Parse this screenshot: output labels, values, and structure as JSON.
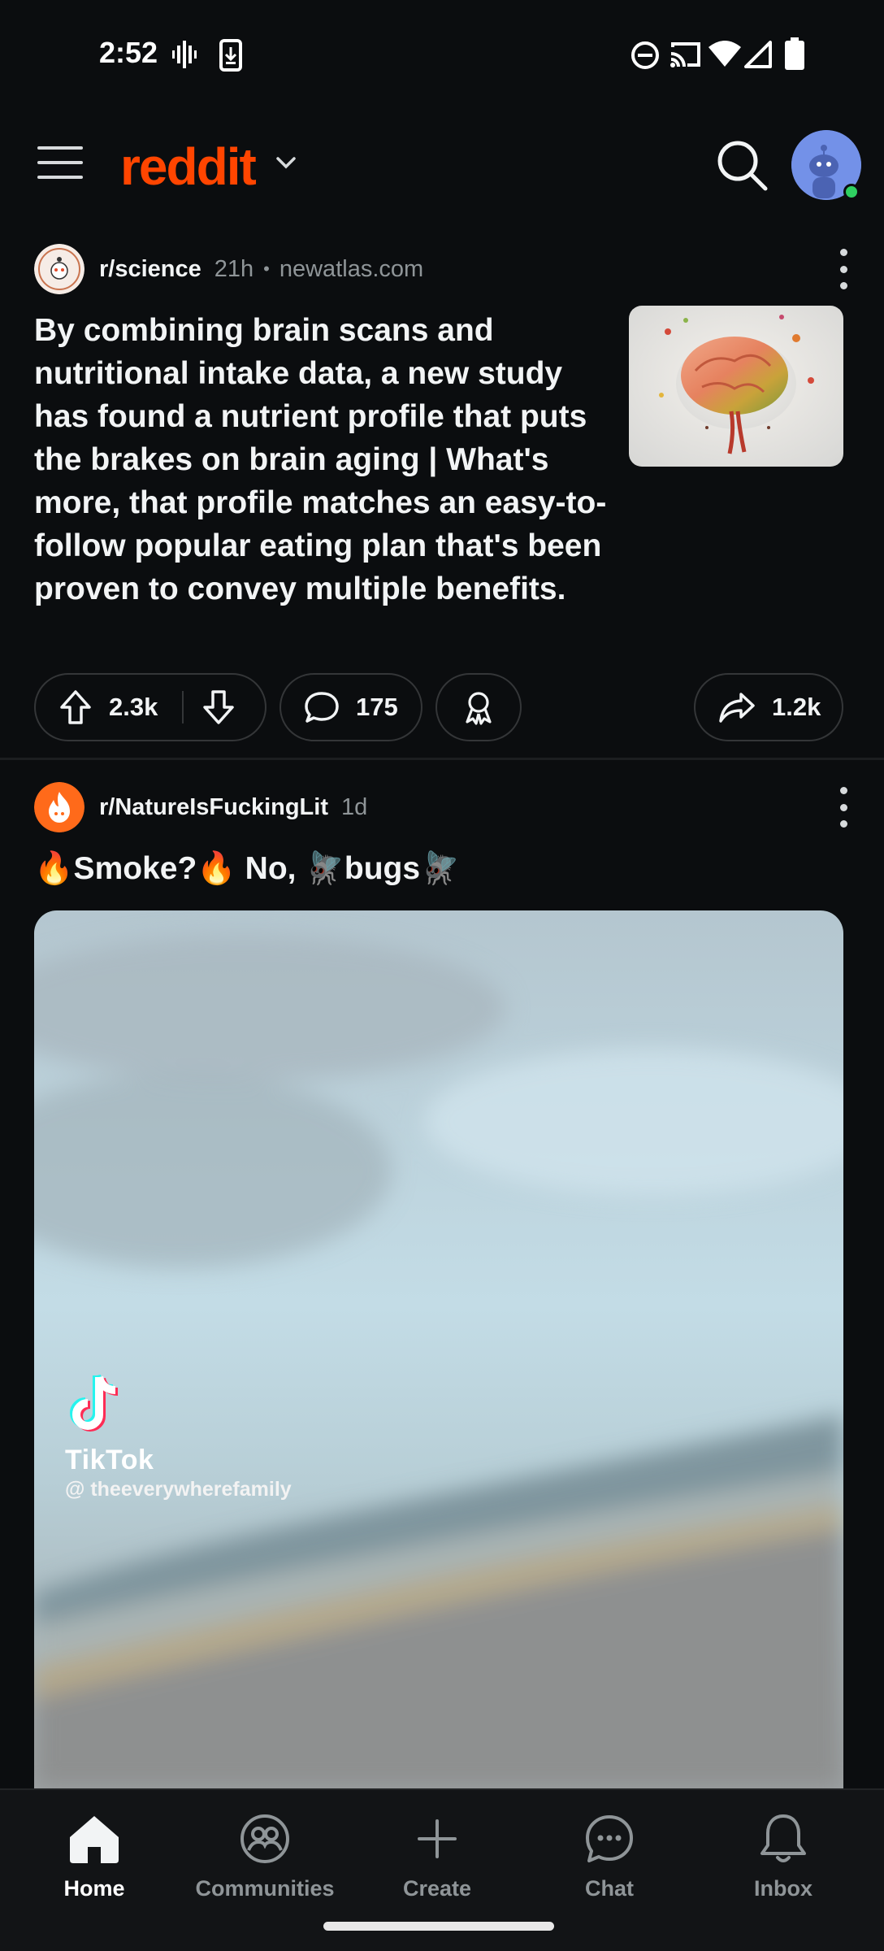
{
  "status_bar": {
    "time": "2:52",
    "icons": [
      "vibrate-icon",
      "download-icon",
      "do-not-disturb-icon",
      "cast-icon",
      "wifi-icon",
      "signal-icon",
      "battery-icon"
    ]
  },
  "header": {
    "logo": "reddit",
    "accent_color": "#ff4500"
  },
  "posts": [
    {
      "subreddit": "r/science",
      "age": "21h",
      "separator": "•",
      "domain": "newatlas.com",
      "title": "By combining brain scans and nutritional intake data, a new study has found a nutrient profile that puts the brakes on brain aging | What's more, that profile matches an easy-to-follow popular eating plan that's been proven to convey multiple benefits.",
      "upvotes": "2.3k",
      "comments": "175",
      "shares": "1.2k"
    },
    {
      "subreddit": "r/NatureIsFuckingLit",
      "age": "1d",
      "title": "🔥Smoke?🔥 No, 🪰bugs🪰",
      "video_watermark": {
        "brand": "TikTok",
        "handle": "@ theeverywherefamily"
      }
    }
  ],
  "bottom_nav": {
    "items": [
      {
        "label": "Home",
        "icon": "home-icon",
        "active": true
      },
      {
        "label": "Communities",
        "icon": "communities-icon",
        "active": false
      },
      {
        "label": "Create",
        "icon": "plus-icon",
        "active": false
      },
      {
        "label": "Chat",
        "icon": "chat-icon",
        "active": false
      },
      {
        "label": "Inbox",
        "icon": "bell-icon",
        "active": false
      }
    ]
  }
}
